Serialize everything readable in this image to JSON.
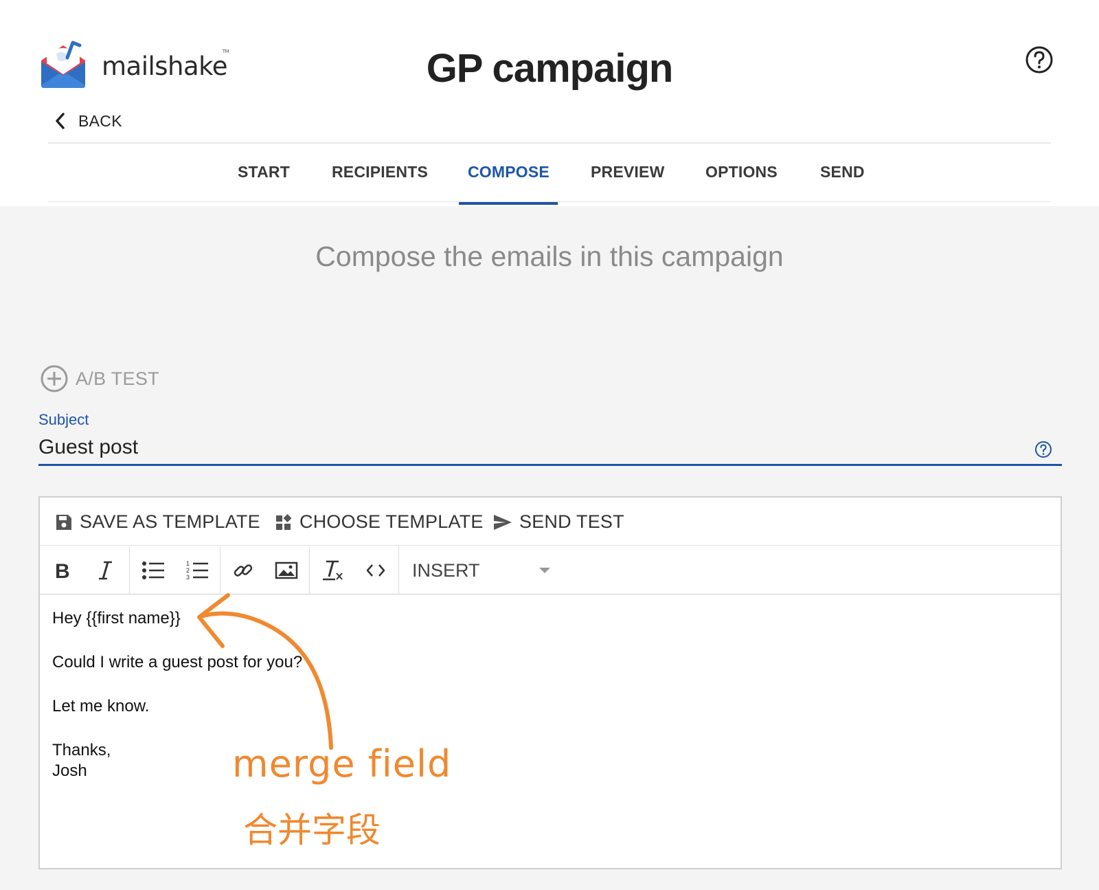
{
  "brand": {
    "name": "mailshake",
    "tm": "TM"
  },
  "header": {
    "title": "GP campaign",
    "back_label": "BACK"
  },
  "tabs": [
    {
      "label": "START",
      "active": false
    },
    {
      "label": "RECIPIENTS",
      "active": false
    },
    {
      "label": "COMPOSE",
      "active": true
    },
    {
      "label": "PREVIEW",
      "active": false
    },
    {
      "label": "OPTIONS",
      "active": false
    },
    {
      "label": "SEND",
      "active": false
    }
  ],
  "main": {
    "heading": "Compose the emails in this campaign",
    "ab_test_label": "A/B TEST"
  },
  "subject": {
    "label": "Subject",
    "value": "Guest post"
  },
  "editor": {
    "actions": {
      "save_template": "SAVE AS TEMPLATE",
      "choose_template": "CHOOSE TEMPLATE",
      "send_test": "SEND TEST"
    },
    "insert_label": "INSERT",
    "body_lines": [
      "Hey {{first name}}",
      "",
      "Could I write a guest post for you?",
      "",
      "Let me know.",
      "",
      "Thanks,",
      "Josh"
    ]
  },
  "annotation": {
    "english": "merge field",
    "chinese": "合并字段",
    "color": "#f0892f"
  },
  "colors": {
    "accent": "#1d55a6",
    "annotation": "#f0892f"
  }
}
